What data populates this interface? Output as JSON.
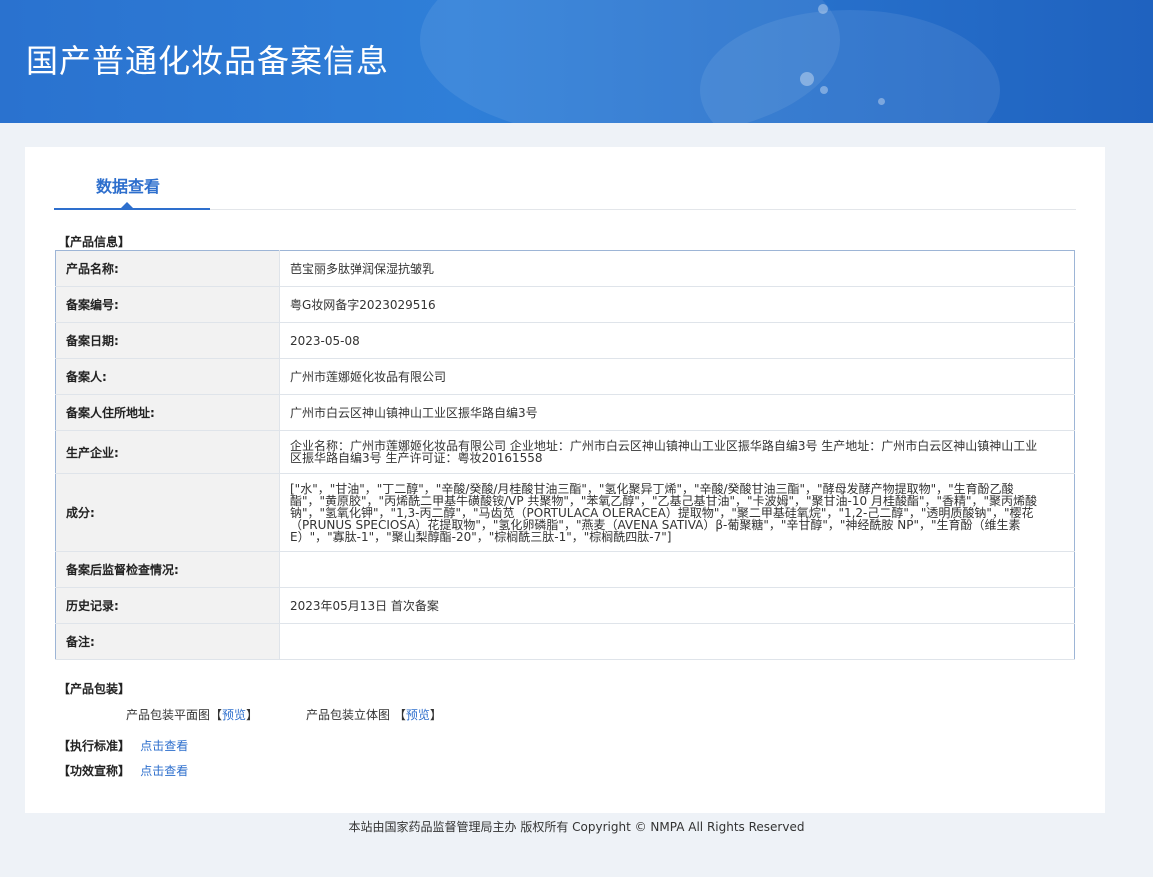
{
  "header": {
    "title": "国产普通化妆品备案信息"
  },
  "tabs": {
    "active_label": "数据查看"
  },
  "product_info": {
    "section_title": "【产品信息】",
    "rows": [
      {
        "label": "产品名称:",
        "value": "芭宝丽多肽弹润保湿抗皱乳"
      },
      {
        "label": "备案编号:",
        "value": "粤G妆网备字2023029516"
      },
      {
        "label": "备案日期:",
        "value": "2023-05-08"
      },
      {
        "label": "备案人:",
        "value": "广州市莲娜姬化妆品有限公司"
      },
      {
        "label": "备案人住所地址:",
        "value": "广州市白云区神山镇神山工业区振华路自编3号"
      },
      {
        "label": "生产企业:",
        "value": "企业名称：广州市莲娜姬化妆品有限公司 企业地址：广州市白云区神山镇神山工业区振华路自编3号 生产地址：广州市白云区神山镇神山工业区振华路自编3号 生产许可证：粤妆20161558"
      },
      {
        "label": "成分:",
        "value": "[\"水\"，\"甘油\"，\"丁二醇\"，\"辛酸/癸酸/月桂酸甘油三酯\"，\"氢化聚异丁烯\"，\"辛酸/癸酸甘油三酯\"，\"酵母发酵产物提取物\"，\"生育酚乙酸酯\"，\"黄原胶\"，\"丙烯酰二甲基牛磺酸铵/VP 共聚物\"，\"苯氧乙醇\"，\"乙基己基甘油\"，\"卡波姆\"，\"聚甘油-10 月桂酸酯\"，\"香精\"，\"聚丙烯酸钠\"，\"氢氧化钾\"，\"1,3-丙二醇\"，\"马齿苋（PORTULACA OLERACEA）提取物\"，\"聚二甲基硅氧烷\"，\"1,2-己二醇\"，\"透明质酸钠\"，\"樱花（PRUNUS SPECIOSA）花提取物\"，\"氢化卵磷脂\"，\"燕麦（AVENA SATIVA）β-葡聚糖\"，\"辛甘醇\"，\"神经酰胺 NP\"，\"生育酚（维生素E）\"，\"寡肽-1\"，\"聚山梨醇酯-20\"，\"棕榈酰三肽-1\"，\"棕榈酰四肽-7\"]"
      },
      {
        "label": "备案后监督检查情况:",
        "value": ""
      },
      {
        "label": "历史记录:",
        "value": "2023年05月13日 首次备案"
      },
      {
        "label": "备注:",
        "value": ""
      }
    ]
  },
  "packaging": {
    "section_title": "【产品包装】",
    "flat_label": "产品包装平面图【",
    "flat_link": "预览",
    "flat_close": "】",
    "stereo_label": "产品包装立体图 【",
    "stereo_link": "预览",
    "stereo_close": "】"
  },
  "standard": {
    "section_title": "【执行标准】",
    "link": "点击查看"
  },
  "efficacy": {
    "section_title": "【功效宣称】",
    "link": "点击查看"
  },
  "footer": {
    "text": "本站由国家药品监督管理局主办 版权所有 Copyright © NMPA All Rights Reserved"
  }
}
